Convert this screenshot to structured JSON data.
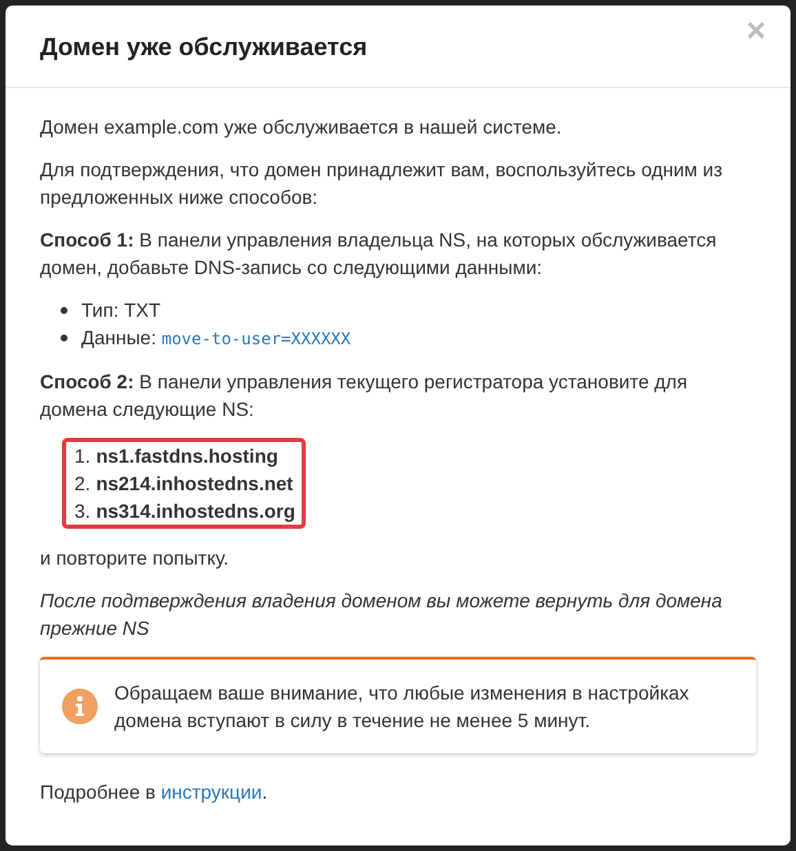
{
  "dialog": {
    "title": "Домен уже обслуживается",
    "close": "×"
  },
  "intro": "Домен example.com уже обслуживается в нашей системе.",
  "prompt": "Для подтверждения, что домен принадлежит вам, воспользуйтесь одним из предложенных ниже способов:",
  "method_1": "**Способ 1:** В панели управления владельца NS, на которых обслуживается домен, добавьте DNS-запись со следующими данными:",
  "record": [
    {
      "label": "Тип:",
      "value": "TXT",
      "kind": "plain"
    },
    {
      "label": "Данные:",
      "value": "move-to-user=XXXXXX",
      "kind": "code"
    }
  ],
  "method_2": "**Способ 2:** В панели управления текущего регистратора установите для домена следующие NS:",
  "ns_servers": [
    {
      "number": "1.",
      "host": "ns1.fastdns.hosting"
    },
    {
      "number": "2.",
      "host": "ns214.inhostedns.net"
    },
    {
      "number": "3.",
      "host": "ns314.inhostedns.org"
    }
  ],
  "retry": "и повторите попытку.",
  "note": "После подтверждения владения доменом вы можете вернуть для домена прежние NS",
  "alert": {
    "text": "Обращаем ваше внимание, что любые изменения в настройках домена вступают в силу в течение не менее 5 минут."
  },
  "footer": {
    "text": "Подробнее в",
    "link": "инструкции",
    "end": "."
  }
}
